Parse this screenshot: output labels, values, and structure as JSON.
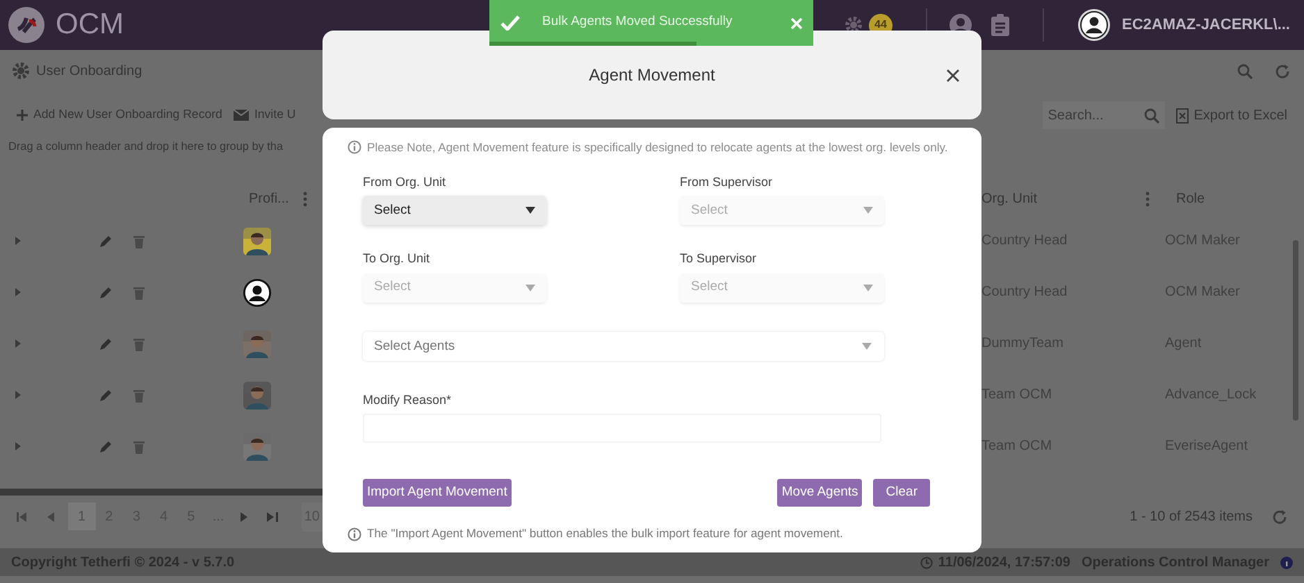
{
  "header": {
    "logo_text": "OCM",
    "notification_count": "44",
    "user_name": "EC2AMAZ-JACERKL\\..."
  },
  "page": {
    "title": "User Onboarding"
  },
  "toolbar": {
    "add_button": "Add New User Onboarding Record",
    "invite_button": "Invite U",
    "search_placeholder": "Search...",
    "export_button": "Export to Excel"
  },
  "group_hint": "Drag a column header and drop it here to group by tha",
  "table": {
    "columns": [
      "Profi...",
      "Org. Unit",
      "Role"
    ],
    "rows": [
      {
        "kind": "picture",
        "org_unit": "Country Head",
        "role": "OCM Maker"
      },
      {
        "kind": "icon",
        "org_unit": "Country Head",
        "role": "OCM Maker"
      },
      {
        "kind": "picture",
        "org_unit": "DummyTeam",
        "role": "Agent"
      },
      {
        "kind": "picture",
        "org_unit": "Team OCM",
        "role": "Advance_Lock"
      },
      {
        "kind": "picture",
        "org_unit": "Team OCM",
        "role": "EveriseAgent"
      }
    ]
  },
  "pager": {
    "pages": [
      {
        "label": "1",
        "selected": true
      },
      {
        "label": "2",
        "selected": false
      },
      {
        "label": "3",
        "selected": false
      },
      {
        "label": "4",
        "selected": false
      },
      {
        "label": "5",
        "selected": false
      }
    ],
    "ellipsis": "...",
    "page_size": "10",
    "summary": "1 - 10 of 2543 items"
  },
  "footer": {
    "copyright": "Copyright Tetherfi © 2024 - v 5.7.0",
    "datetime": "11/06/2024, 17:57:09",
    "app_name": "Operations Control Manager"
  },
  "toast": {
    "message": "Bulk Agents Moved Successfully",
    "level": 0.64
  },
  "modal": {
    "title": "Agent Movement",
    "note": "Please Note, Agent Movement feature is specifically designed to relocate agents at the lowest org. levels only.",
    "fields": [
      {
        "label": "From Org. Unit",
        "value": "Select",
        "disabled": false
      },
      {
        "label": "From Supervisor",
        "value": "Select",
        "disabled": true
      },
      {
        "label": "To Org. Unit",
        "value": "Select",
        "disabled": true
      },
      {
        "label": "To Supervisor",
        "value": "Select",
        "disabled": true
      }
    ],
    "agents": {
      "placeholder": "Select Agents"
    },
    "reason": {
      "label": "Modify Reason*"
    },
    "buttons": [
      {
        "label": "Import Agent Movement"
      },
      {
        "label": "Move Agents"
      },
      {
        "label": "Clear"
      }
    ],
    "footnote": "The \"Import Agent Movement\" button enables the bulk import feature for agent movement."
  }
}
